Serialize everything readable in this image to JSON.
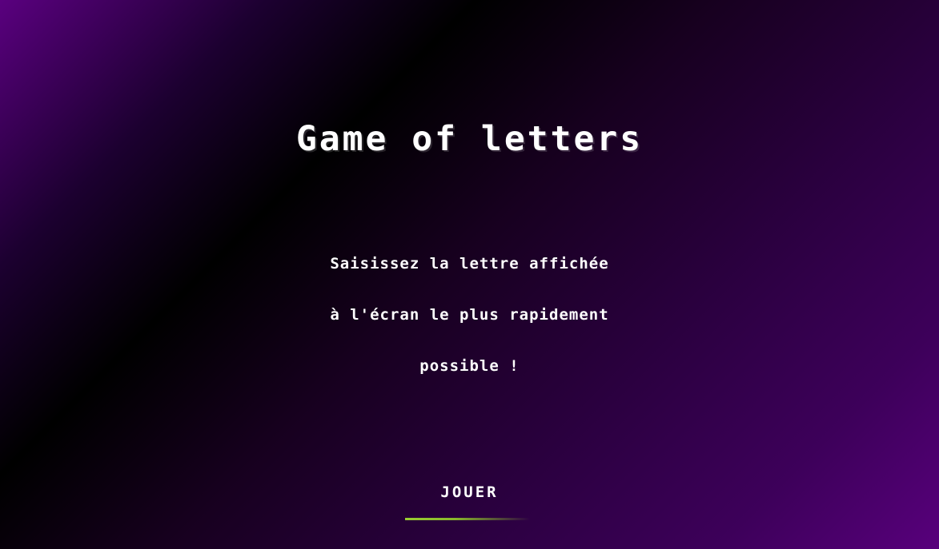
{
  "game": {
    "title": "Game of letters",
    "instructions": [
      "Saisissez la lettre affichée",
      "à l'écran le plus rapidement",
      "possible !"
    ],
    "play_label": "JOUER"
  },
  "colors": {
    "background_purple": "#5a007f",
    "background_dark": "#000000",
    "text": "#ffffff",
    "underline_accent": "#9acd32"
  }
}
